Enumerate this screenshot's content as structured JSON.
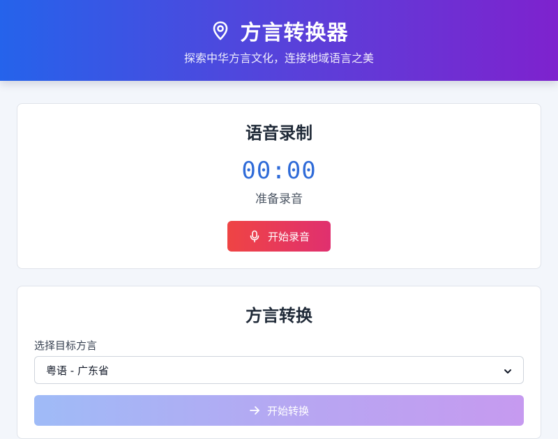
{
  "header": {
    "title": "方言转换器",
    "subtitle": "探索中华方言文化，连接地域语言之美",
    "icon": "map-pin-icon"
  },
  "recording": {
    "title": "语音录制",
    "timer": "00:00",
    "status": "准备录音",
    "button_label": "开始录音",
    "button_icon": "microphone-icon"
  },
  "conversion": {
    "title": "方言转换",
    "field_label": "选择目标方言",
    "selected_dialect": "粤语 - 广东省",
    "button_label": "开始转换",
    "button_icon": "arrow-right-icon"
  },
  "colors": {
    "header_gradient_start": "#2563eb",
    "header_gradient_end": "#7e22ce",
    "timer": "#2f6bd8",
    "record_button_start": "#ef4444",
    "record_button_end": "#e0306f"
  }
}
